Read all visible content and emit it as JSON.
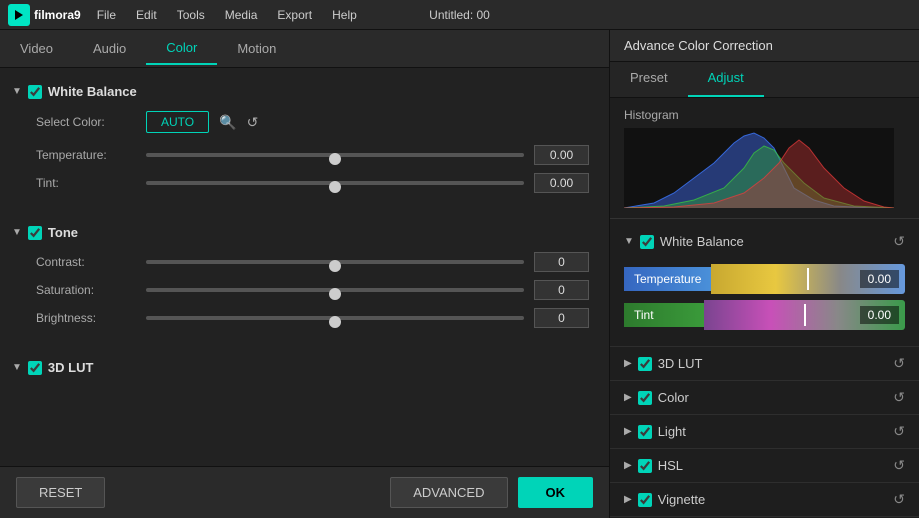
{
  "menubar": {
    "logo_text": "filmora9",
    "items": [
      "File",
      "Edit",
      "Tools",
      "Media",
      "Export",
      "Help"
    ],
    "title": "Untitled: 00"
  },
  "left_panel": {
    "tabs": [
      {
        "label": "Video",
        "active": false
      },
      {
        "label": "Audio",
        "active": false
      },
      {
        "label": "Color",
        "active": true
      },
      {
        "label": "Motion",
        "active": false
      }
    ],
    "sections": [
      {
        "id": "white-balance",
        "title": "White Balance",
        "enabled": true,
        "expanded": true,
        "select_color_label": "Select Color:",
        "auto_btn": "AUTO",
        "sliders": [
          {
            "label": "Temperature:",
            "value": "0.00"
          },
          {
            "label": "Tint:",
            "value": "0.00"
          }
        ]
      },
      {
        "id": "tone",
        "title": "Tone",
        "enabled": true,
        "expanded": true,
        "sliders": [
          {
            "label": "Contrast:",
            "value": "0"
          },
          {
            "label": "Saturation:",
            "value": "0"
          },
          {
            "label": "Brightness:",
            "value": "0"
          }
        ]
      },
      {
        "id": "3d-lut",
        "title": "3D LUT",
        "enabled": true,
        "expanded": false
      }
    ],
    "buttons": {
      "reset": "RESET",
      "advanced": "ADVANCED",
      "ok": "OK"
    }
  },
  "right_panel": {
    "title": "Advance Color Correction",
    "tabs": [
      {
        "label": "Preset",
        "active": false
      },
      {
        "label": "Adjust",
        "active": true
      }
    ],
    "histogram_label": "Histogram",
    "sections": [
      {
        "id": "white-balance-right",
        "title": "White Balance",
        "enabled": true,
        "expanded": true,
        "sliders": [
          {
            "label": "Temperature",
            "value": "0.00",
            "type": "temperature"
          },
          {
            "label": "Tint",
            "value": "0.00",
            "type": "tint"
          }
        ]
      },
      {
        "id": "3d-lut-right",
        "title": "3D LUT",
        "enabled": true,
        "expanded": false
      },
      {
        "id": "color-right",
        "title": "Color",
        "enabled": true,
        "expanded": false
      },
      {
        "id": "light-right",
        "title": "Light",
        "enabled": true,
        "expanded": false
      },
      {
        "id": "hsl-right",
        "title": "HSL",
        "enabled": true,
        "expanded": false
      },
      {
        "id": "vignette-right",
        "title": "Vignette",
        "enabled": true,
        "expanded": false
      }
    ]
  }
}
